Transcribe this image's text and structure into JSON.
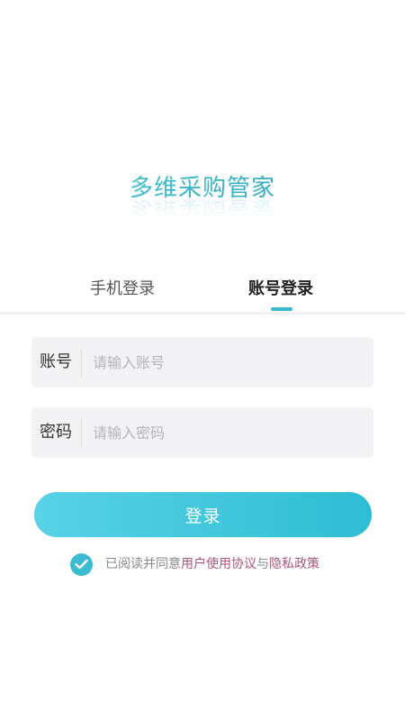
{
  "app": {
    "title": "多维采购管家"
  },
  "tabs": {
    "phone_label": "手机登录",
    "account_label": "账号登录",
    "active": "account"
  },
  "form": {
    "account": {
      "label": "账号",
      "placeholder": "请输入账号",
      "value": ""
    },
    "password": {
      "label": "密码",
      "placeholder": "请输入密码",
      "value": ""
    }
  },
  "login_button": {
    "label": "登录"
  },
  "agreement": {
    "checked": true,
    "prefix": "已阅读并同意",
    "user_agreement": "用户使用协议",
    "conjunction": "与",
    "privacy_policy": "隐私政策"
  },
  "colors": {
    "accent": "#3BBACF",
    "link": "#B0557D",
    "input_bg": "#F3F3F5"
  },
  "icons": {
    "agreement_check": "check-circle-icon"
  }
}
